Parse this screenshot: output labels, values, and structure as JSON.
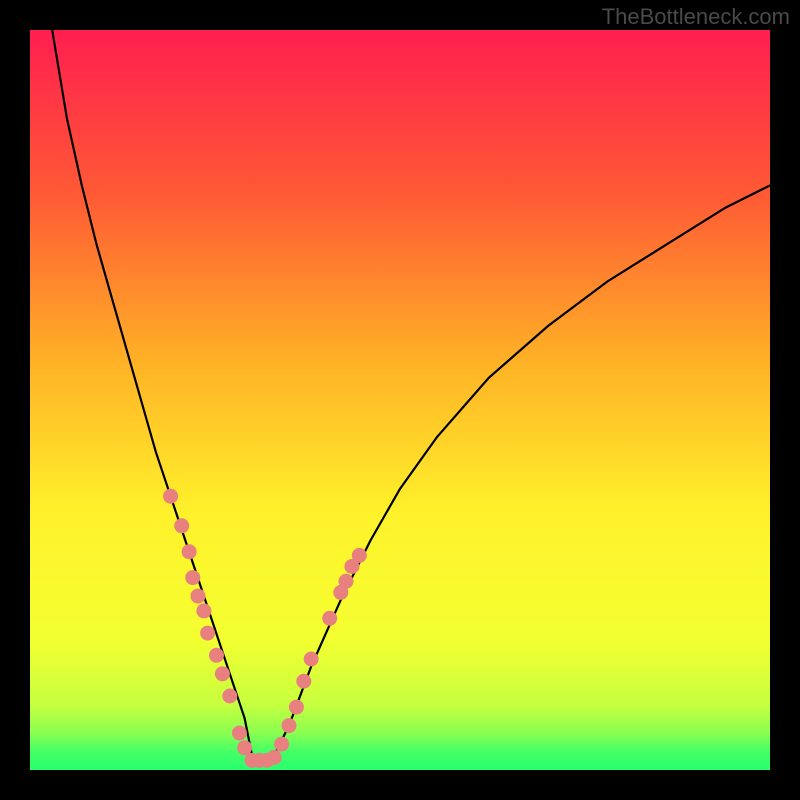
{
  "watermark": "TheBottleneck.com",
  "colors": {
    "gradient_top": "#ff1e50",
    "gradient_upper_mid": "#ff6930",
    "gradient_mid": "#ffc223",
    "gradient_lower_mid": "#fff82d",
    "gradient_lower": "#dfff3a",
    "gradient_bottom": "#2dff6c",
    "curve_stroke": "#000000",
    "marker_fill": "#e88080",
    "frame": "#000000"
  },
  "chart_data": {
    "type": "line",
    "title": "",
    "xlabel": "",
    "ylabel": "",
    "xlim": [
      0,
      100
    ],
    "ylim": [
      0,
      100
    ],
    "series": [
      {
        "name": "bottleneck-curve",
        "x": [
          3,
          5,
          7,
          9,
          11,
          13,
          15,
          17,
          19,
          21,
          23,
          25,
          27,
          29,
          30,
          31,
          33,
          35,
          38,
          42,
          46,
          50,
          55,
          62,
          70,
          78,
          86,
          94,
          100
        ],
        "values": [
          100,
          88,
          79,
          71,
          64,
          57,
          50,
          43,
          37,
          31,
          25,
          19,
          13,
          7,
          2,
          1,
          2,
          6,
          14,
          23,
          31,
          38,
          45,
          53,
          60,
          66,
          71,
          76,
          79
        ]
      }
    ],
    "markers": [
      {
        "x": 19,
        "y": 37
      },
      {
        "x": 20.5,
        "y": 33
      },
      {
        "x": 21.5,
        "y": 29.5
      },
      {
        "x": 22,
        "y": 26
      },
      {
        "x": 22.7,
        "y": 23.5
      },
      {
        "x": 23.5,
        "y": 21.5
      },
      {
        "x": 24,
        "y": 18.5
      },
      {
        "x": 25.2,
        "y": 15.5
      },
      {
        "x": 26,
        "y": 13
      },
      {
        "x": 27,
        "y": 10
      },
      {
        "x": 28.3,
        "y": 5
      },
      {
        "x": 29,
        "y": 3
      },
      {
        "x": 30,
        "y": 1.3
      },
      {
        "x": 31,
        "y": 1.3
      },
      {
        "x": 32,
        "y": 1.3
      },
      {
        "x": 33,
        "y": 1.7
      },
      {
        "x": 34,
        "y": 3.5
      },
      {
        "x": 35,
        "y": 6
      },
      {
        "x": 36,
        "y": 8.5
      },
      {
        "x": 37,
        "y": 12
      },
      {
        "x": 38,
        "y": 15
      },
      {
        "x": 40.5,
        "y": 20.5
      },
      {
        "x": 42,
        "y": 24
      },
      {
        "x": 42.7,
        "y": 25.5
      },
      {
        "x": 43.5,
        "y": 27.5
      },
      {
        "x": 44.5,
        "y": 29
      }
    ]
  }
}
